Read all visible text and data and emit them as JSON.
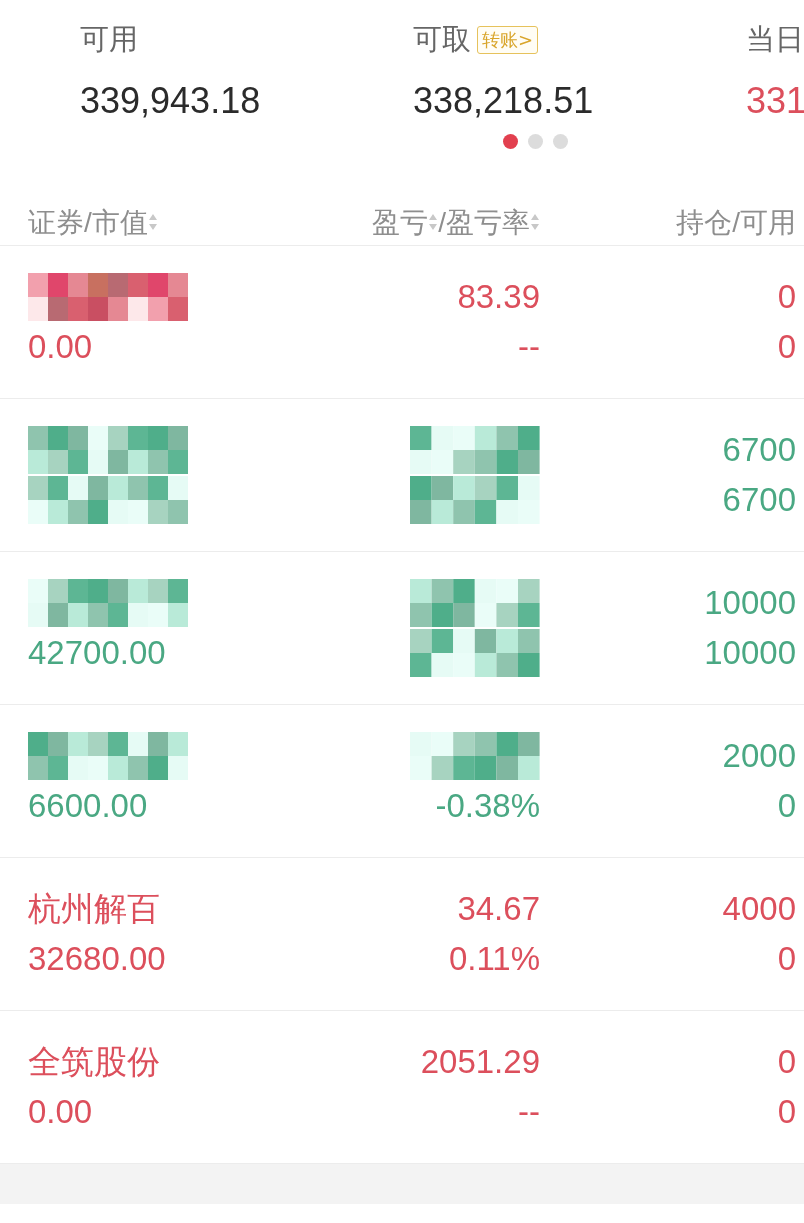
{
  "summary": [
    {
      "label": "可用",
      "value": "339,943.18",
      "kind": "plain"
    },
    {
      "label": "可取",
      "badge": "转账>",
      "value": "338,218.51",
      "kind": "plain"
    },
    {
      "label": "当日",
      "value": "331",
      "kind": "up"
    }
  ],
  "pager": [
    {
      "selected": true
    },
    {
      "selected": false
    },
    {
      "selected": false
    }
  ],
  "columns": [
    {
      "label": "证券/市值",
      "sortable": true
    },
    {
      "label": "盈亏",
      "sortable": true,
      "label_2": "/盈亏率",
      "sortable_2": true
    },
    {
      "label": "持仓/可用",
      "sortable": false
    }
  ],
  "rows": [
    {
      "kind": "up",
      "name": null,
      "market_value": "0.00",
      "pnl": "83.39",
      "pnl_rate": "--",
      "holding": "0",
      "available": "0"
    },
    {
      "kind": "down",
      "name": null,
      "market_value": null,
      "pnl": null,
      "pnl_rate": null,
      "holding": "6700",
      "available": "6700"
    },
    {
      "kind": "down",
      "name": null,
      "market_value": "42700.00",
      "pnl": null,
      "pnl_rate": null,
      "holding": "10000",
      "available": "10000"
    },
    {
      "kind": "down",
      "name": null,
      "market_value": "6600.00",
      "pnl": null,
      "pnl_rate": "-0.38%",
      "holding": "2000",
      "available": "0"
    },
    {
      "kind": "up",
      "name": "杭州解百",
      "market_value": "32680.00",
      "pnl": "34.67",
      "pnl_rate": "0.11%",
      "holding": "4000",
      "available": "0"
    },
    {
      "kind": "up",
      "name": "全筑股份",
      "market_value": "0.00",
      "pnl": "2051.29",
      "pnl_rate": "--",
      "holding": "0",
      "available": "0"
    }
  ]
}
